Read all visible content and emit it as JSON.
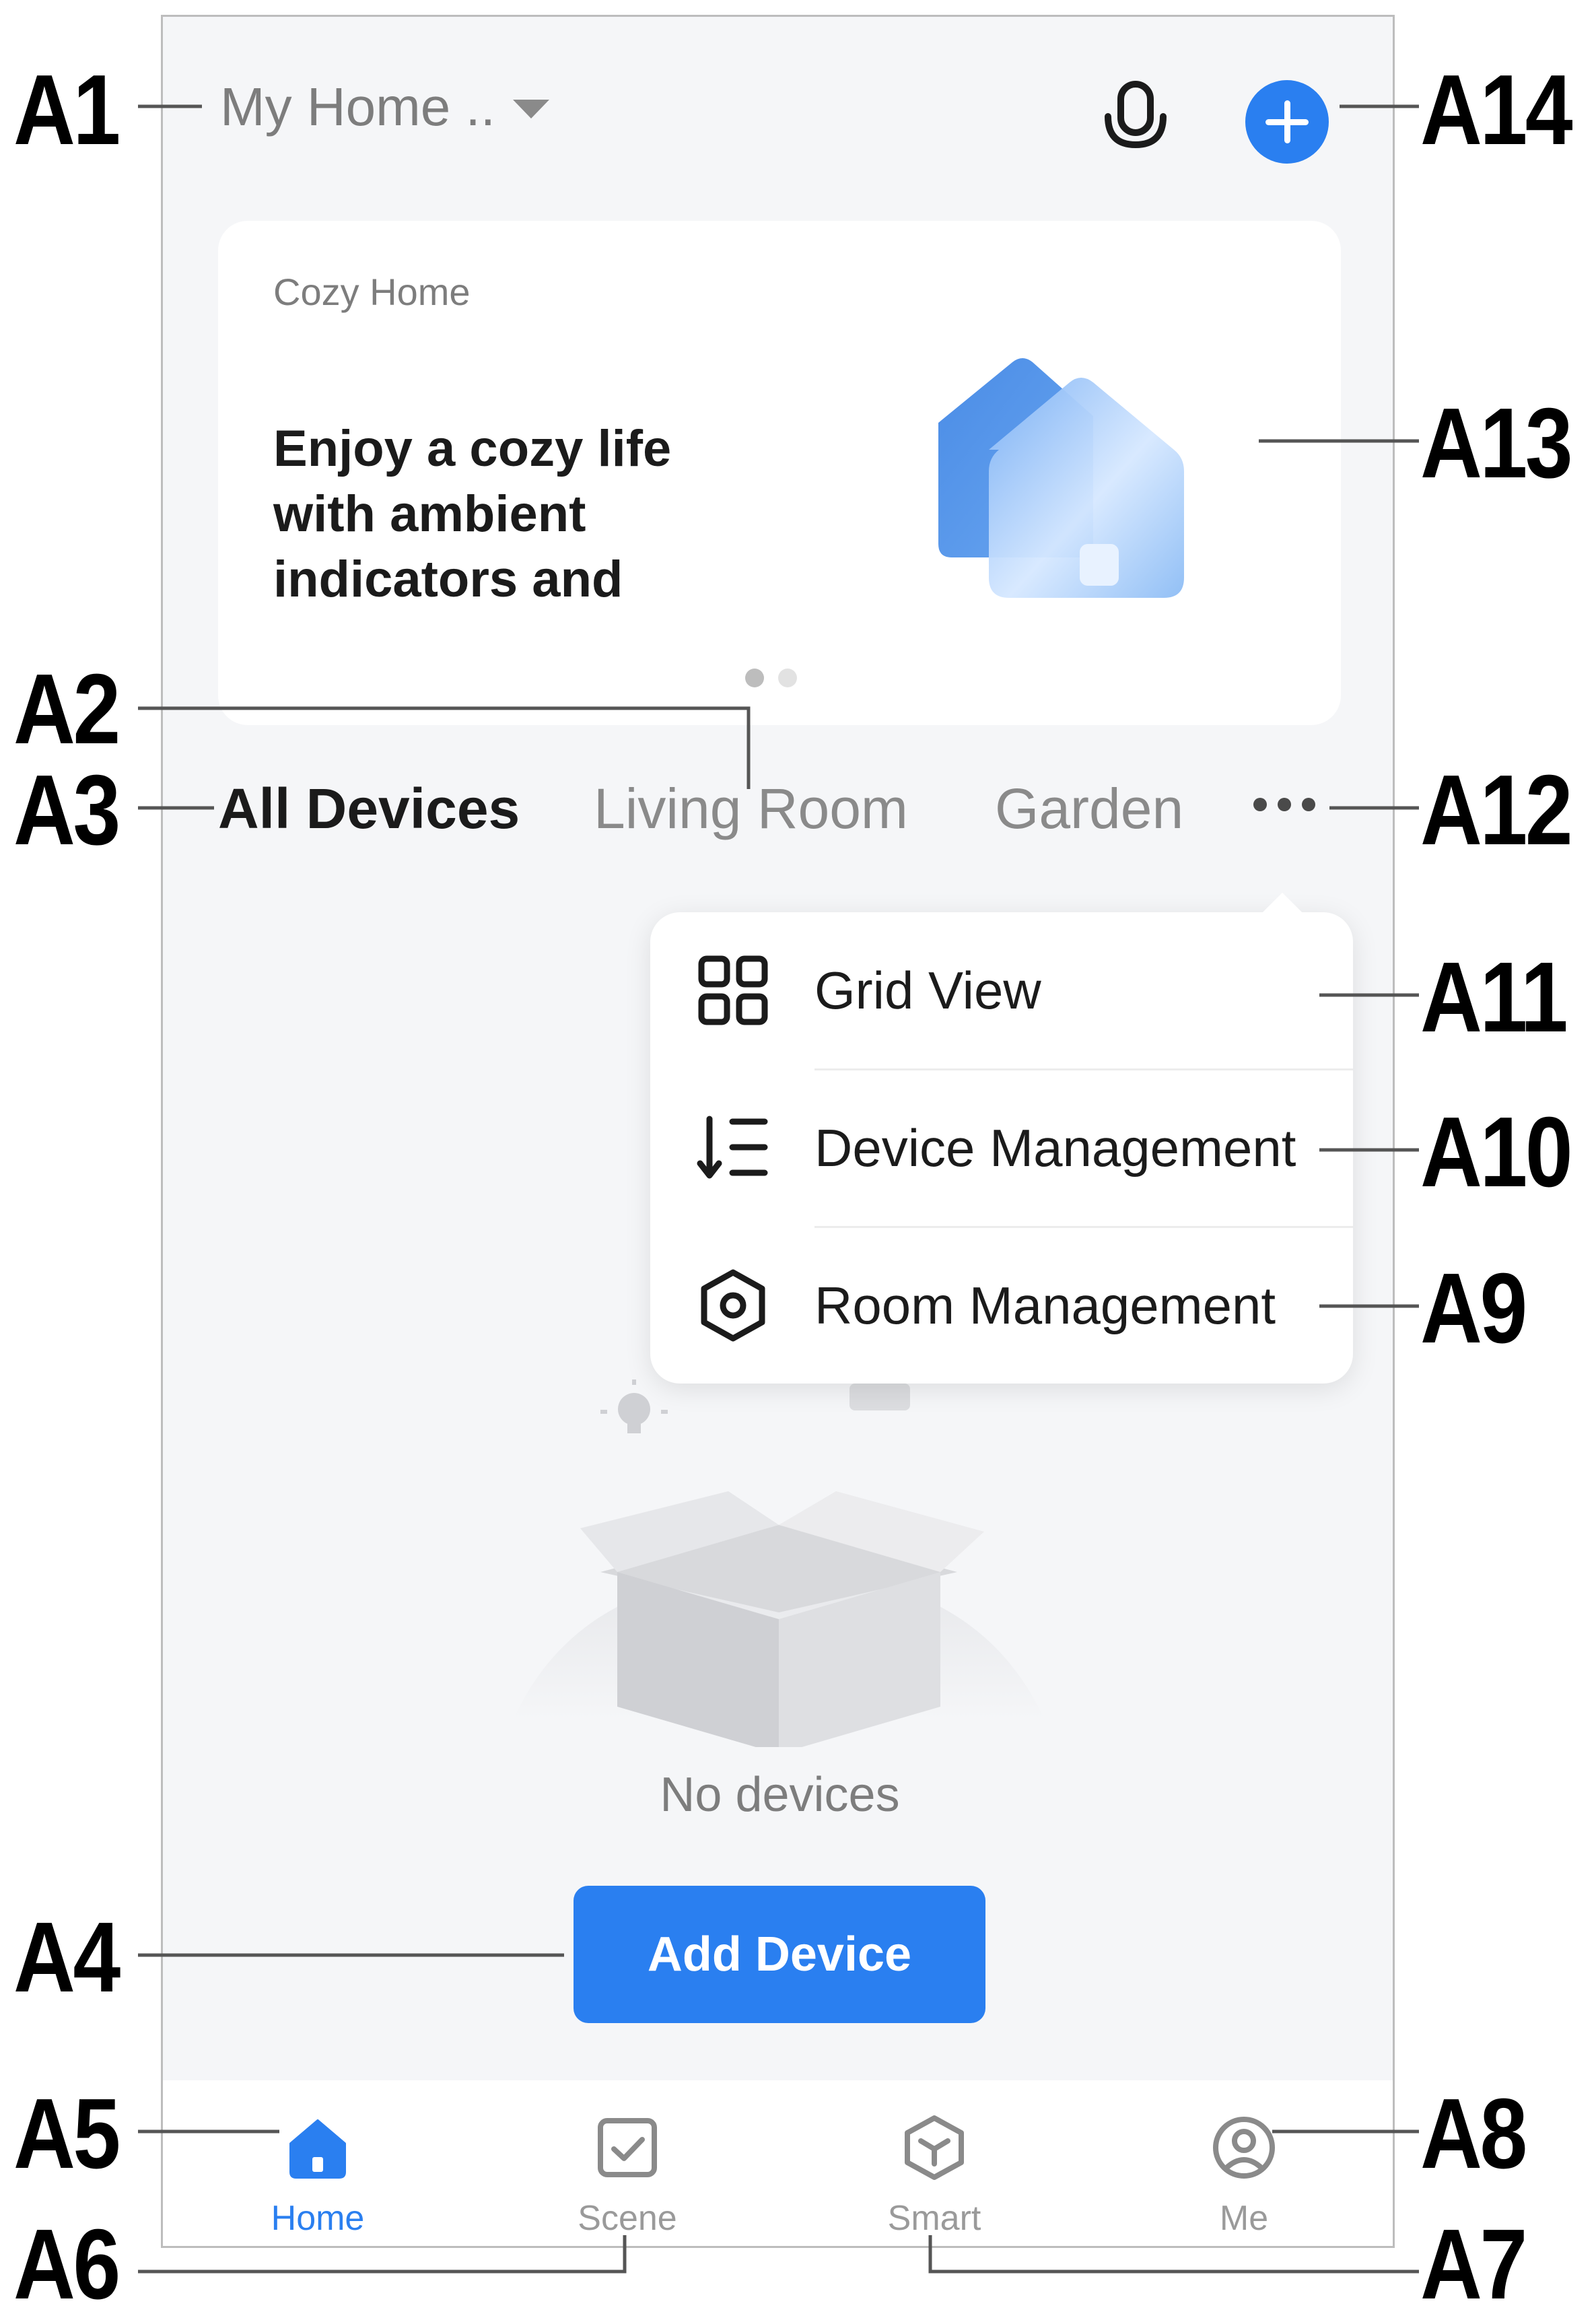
{
  "header": {
    "home_name": "My Home ..",
    "mic_icon": "microphone-icon",
    "add_icon": "plus-circle-icon",
    "accent_color": "#2a7ff0"
  },
  "banner": {
    "label": "Cozy Home",
    "headline": "Enjoy a cozy life with ambient indicators and",
    "art_icon": "house-illustration",
    "pages": 2,
    "active_page": 1
  },
  "tabs": [
    {
      "label": "All Devices",
      "active": true
    },
    {
      "label": "Living Room",
      "active": false
    },
    {
      "label": "Garden",
      "active": false
    }
  ],
  "more_icon": "more-horizontal-icon",
  "popup_menu": [
    {
      "label": "Grid View",
      "icon": "grid-icon"
    },
    {
      "label": "Device Management",
      "icon": "sort-list-icon"
    },
    {
      "label": "Room Management",
      "icon": "hexagon-settings-icon"
    }
  ],
  "empty_state": {
    "message": "No devices",
    "button_label": "Add Device"
  },
  "bottom_nav": [
    {
      "label": "Home",
      "icon": "home-icon",
      "active": true
    },
    {
      "label": "Scene",
      "icon": "checkbox-icon",
      "active": false
    },
    {
      "label": "Smart",
      "icon": "cube-icon",
      "active": false
    },
    {
      "label": "Me",
      "icon": "user-icon",
      "active": false
    }
  ],
  "callouts": [
    "A1",
    "A2",
    "A3",
    "A4",
    "A5",
    "A6",
    "A7",
    "A8",
    "A9",
    "A10",
    "A11",
    "A12",
    "A13",
    "A14"
  ]
}
